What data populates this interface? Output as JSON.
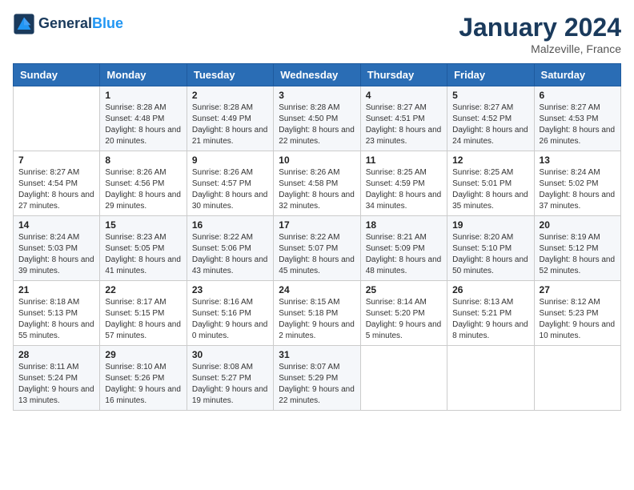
{
  "header": {
    "logo_general": "General",
    "logo_blue": "Blue",
    "month_year": "January 2024",
    "location": "Malzeville, France"
  },
  "days_of_week": [
    "Sunday",
    "Monday",
    "Tuesday",
    "Wednesday",
    "Thursday",
    "Friday",
    "Saturday"
  ],
  "weeks": [
    [
      {
        "day": "",
        "content": ""
      },
      {
        "day": "1",
        "content": "Sunrise: 8:28 AM\nSunset: 4:48 PM\nDaylight: 8 hours\nand 20 minutes."
      },
      {
        "day": "2",
        "content": "Sunrise: 8:28 AM\nSunset: 4:49 PM\nDaylight: 8 hours\nand 21 minutes."
      },
      {
        "day": "3",
        "content": "Sunrise: 8:28 AM\nSunset: 4:50 PM\nDaylight: 8 hours\nand 22 minutes."
      },
      {
        "day": "4",
        "content": "Sunrise: 8:27 AM\nSunset: 4:51 PM\nDaylight: 8 hours\nand 23 minutes."
      },
      {
        "day": "5",
        "content": "Sunrise: 8:27 AM\nSunset: 4:52 PM\nDaylight: 8 hours\nand 24 minutes."
      },
      {
        "day": "6",
        "content": "Sunrise: 8:27 AM\nSunset: 4:53 PM\nDaylight: 8 hours\nand 26 minutes."
      }
    ],
    [
      {
        "day": "7",
        "content": "Sunrise: 8:27 AM\nSunset: 4:54 PM\nDaylight: 8 hours\nand 27 minutes."
      },
      {
        "day": "8",
        "content": "Sunrise: 8:26 AM\nSunset: 4:56 PM\nDaylight: 8 hours\nand 29 minutes."
      },
      {
        "day": "9",
        "content": "Sunrise: 8:26 AM\nSunset: 4:57 PM\nDaylight: 8 hours\nand 30 minutes."
      },
      {
        "day": "10",
        "content": "Sunrise: 8:26 AM\nSunset: 4:58 PM\nDaylight: 8 hours\nand 32 minutes."
      },
      {
        "day": "11",
        "content": "Sunrise: 8:25 AM\nSunset: 4:59 PM\nDaylight: 8 hours\nand 34 minutes."
      },
      {
        "day": "12",
        "content": "Sunrise: 8:25 AM\nSunset: 5:01 PM\nDaylight: 8 hours\nand 35 minutes."
      },
      {
        "day": "13",
        "content": "Sunrise: 8:24 AM\nSunset: 5:02 PM\nDaylight: 8 hours\nand 37 minutes."
      }
    ],
    [
      {
        "day": "14",
        "content": "Sunrise: 8:24 AM\nSunset: 5:03 PM\nDaylight: 8 hours\nand 39 minutes."
      },
      {
        "day": "15",
        "content": "Sunrise: 8:23 AM\nSunset: 5:05 PM\nDaylight: 8 hours\nand 41 minutes."
      },
      {
        "day": "16",
        "content": "Sunrise: 8:22 AM\nSunset: 5:06 PM\nDaylight: 8 hours\nand 43 minutes."
      },
      {
        "day": "17",
        "content": "Sunrise: 8:22 AM\nSunset: 5:07 PM\nDaylight: 8 hours\nand 45 minutes."
      },
      {
        "day": "18",
        "content": "Sunrise: 8:21 AM\nSunset: 5:09 PM\nDaylight: 8 hours\nand 48 minutes."
      },
      {
        "day": "19",
        "content": "Sunrise: 8:20 AM\nSunset: 5:10 PM\nDaylight: 8 hours\nand 50 minutes."
      },
      {
        "day": "20",
        "content": "Sunrise: 8:19 AM\nSunset: 5:12 PM\nDaylight: 8 hours\nand 52 minutes."
      }
    ],
    [
      {
        "day": "21",
        "content": "Sunrise: 8:18 AM\nSunset: 5:13 PM\nDaylight: 8 hours\nand 55 minutes."
      },
      {
        "day": "22",
        "content": "Sunrise: 8:17 AM\nSunset: 5:15 PM\nDaylight: 8 hours\nand 57 minutes."
      },
      {
        "day": "23",
        "content": "Sunrise: 8:16 AM\nSunset: 5:16 PM\nDaylight: 9 hours\nand 0 minutes."
      },
      {
        "day": "24",
        "content": "Sunrise: 8:15 AM\nSunset: 5:18 PM\nDaylight: 9 hours\nand 2 minutes."
      },
      {
        "day": "25",
        "content": "Sunrise: 8:14 AM\nSunset: 5:20 PM\nDaylight: 9 hours\nand 5 minutes."
      },
      {
        "day": "26",
        "content": "Sunrise: 8:13 AM\nSunset: 5:21 PM\nDaylight: 9 hours\nand 8 minutes."
      },
      {
        "day": "27",
        "content": "Sunrise: 8:12 AM\nSunset: 5:23 PM\nDaylight: 9 hours\nand 10 minutes."
      }
    ],
    [
      {
        "day": "28",
        "content": "Sunrise: 8:11 AM\nSunset: 5:24 PM\nDaylight: 9 hours\nand 13 minutes."
      },
      {
        "day": "29",
        "content": "Sunrise: 8:10 AM\nSunset: 5:26 PM\nDaylight: 9 hours\nand 16 minutes."
      },
      {
        "day": "30",
        "content": "Sunrise: 8:08 AM\nSunset: 5:27 PM\nDaylight: 9 hours\nand 19 minutes."
      },
      {
        "day": "31",
        "content": "Sunrise: 8:07 AM\nSunset: 5:29 PM\nDaylight: 9 hours\nand 22 minutes."
      },
      {
        "day": "",
        "content": ""
      },
      {
        "day": "",
        "content": ""
      },
      {
        "day": "",
        "content": ""
      }
    ]
  ]
}
